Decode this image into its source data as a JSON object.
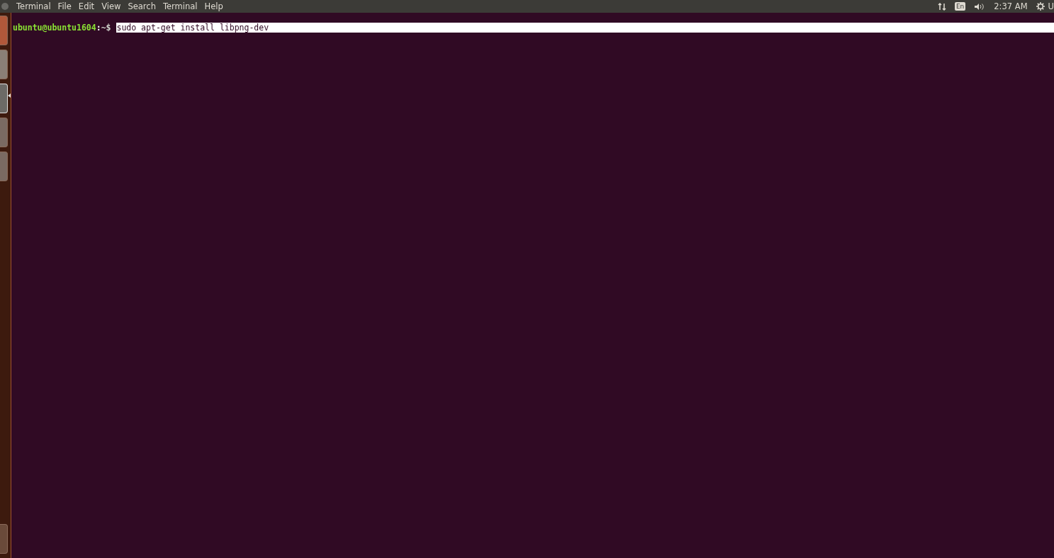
{
  "top_bar": {
    "app_icon": "Terminal",
    "menu": [
      "File",
      "Edit",
      "View",
      "Search",
      "Terminal",
      "Help"
    ],
    "keyboard": "En",
    "time": "2:37 AM",
    "user": "U"
  },
  "launcher": [
    {
      "kind": "dash",
      "focused": false
    },
    {
      "kind": "files",
      "focused": false
    },
    {
      "kind": "terminal",
      "focused": true
    },
    {
      "kind": "settings",
      "focused": false
    },
    {
      "kind": "tools",
      "focused": false
    }
  ],
  "terminal": {
    "user_host": "ubuntu@ubuntu1604",
    "separator": ":",
    "path": "~$",
    "command": "sudo apt-get install libpng-dev",
    "selected": true
  }
}
